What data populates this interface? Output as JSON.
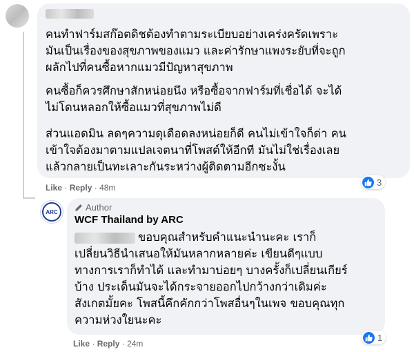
{
  "comment": {
    "lines_p1": [
      "คนทำฟาร์มสก๊อตดิชต้องทำตามระเบียบอย่างเคร่งครัดเพราะ",
      "มันเป็นเรื่องของสุขภาพของแมว และค่ารักษาแพงระยับที่จะถูก",
      "ผลักไปที่คนซื้อหากแมวมีปัญหาสุขภาพ"
    ],
    "lines_p2": [
      "คนซื้อก็ควรศึกษาสักหน่อยนึง หรือซื้อจากฟาร์มที่เชื่อได้ จะได้",
      "ไม่โดนหลอกให้ซื้อแมวที่สุขภาพไม่ดี"
    ],
    "lines_p3": [
      "ส่วนแอดมิน ลดๆความดุเดือดลงหน่อยก็ดี คนไม่เข้าใจก็ด่า คน",
      "เข้าใจต้องมาตามแปลเจตนาที่โพสต์ให้อีกที มันไม่ใช่เรื่องเลย",
      "แล้วกลายเป็นทะเลาะกันระหว่างผู้ติดตามอีกซะงั้น"
    ],
    "like_label": "Like",
    "reply_label": "Reply",
    "time": "48m",
    "reaction_count": "3"
  },
  "reply": {
    "author_badge": "Author",
    "page_name": "WCF Thailand by ARC",
    "avatar_text": "ARC",
    "lines": [
      "ขอบคุณสำหรับคำแนะนำนะคะ เราก็",
      "เปลี่ยนวิธีนำเสนอให้มันหลากหลายค่ะ เขียนดีๆแบบ",
      "ทางการเราก็ทำได้ และทำมาบ่อยๆ บางครั้งก็เปลี่ยนเกียร์",
      "บ้าง ประเด็นมันจะได้กระจายออกไปกว้างกว่าเดิมค่ะ",
      "สังเกตมั้ยคะ โพสนี้คึกคักกว่าโพสอื่นๆในเพจ ขอบคุณทุก",
      "ความห่วงใยนะคะ"
    ],
    "like_label": "Like",
    "reply_label": "Reply",
    "time": "24m",
    "reaction_count": "1"
  },
  "colors": {
    "like_blue": "#1877f2",
    "bubble_bg": "#f0f2f5",
    "meta_gray": "#65676b",
    "arc_blue": "#1f3c8f"
  }
}
